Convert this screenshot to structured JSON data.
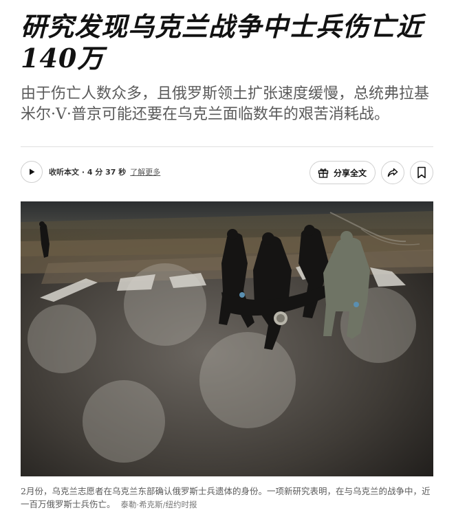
{
  "article": {
    "headline": "研究发现乌克兰战争中士兵伤亡近140万",
    "summary": "由于伤亡人数众多，且俄罗斯领土扩张速度缓慢，总统弗拉基米尔·V·普京可能还要在乌克兰面临数年的艰苦消耗战。"
  },
  "audio": {
    "label": "收听本文 · 4 分 37 秒",
    "learn_more": "了解更多"
  },
  "actions": {
    "share_label": "分享全文",
    "icons": [
      "gift-icon",
      "share-arrow-icon",
      "bookmark-icon"
    ]
  },
  "photo": {
    "caption": "2月份，乌克兰志愿者在乌克兰东部确认俄罗斯士兵遗体的身份。一项新研究表明，在与乌克兰的战争中，近一百万俄罗斯士兵伤亡。",
    "credit": "泰勒·希克斯/纽约时报"
  }
}
